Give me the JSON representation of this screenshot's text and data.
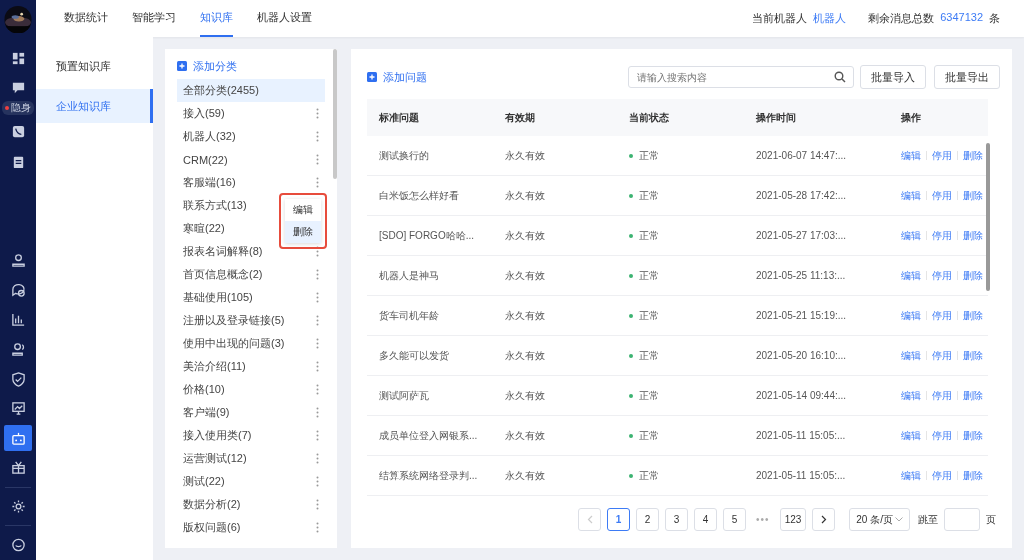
{
  "sidebar": {
    "status_badge": "隐身",
    "items": [
      {
        "selected": false
      },
      {
        "selected": false
      },
      {
        "selected": false
      },
      {
        "selected": false
      },
      {
        "selected": false
      },
      {
        "selected": false
      },
      {
        "selected": false
      },
      {
        "selected": false
      },
      {
        "selected": false
      },
      {
        "selected": false
      },
      {
        "selected": true
      },
      {
        "selected": false
      },
      {
        "selected": false
      },
      {
        "selected": false
      }
    ]
  },
  "top_tabs": [
    {
      "label": "数据统计",
      "selected": false
    },
    {
      "label": "智能学习",
      "selected": false
    },
    {
      "label": "知识库",
      "selected": true
    },
    {
      "label": "机器人设置",
      "selected": false
    }
  ],
  "header_info": {
    "robot_label": "当前机器人",
    "robot_name": "机器人",
    "messages_label": "剩余消息总数",
    "messages_count": "6347132",
    "messages_unit": "条"
  },
  "submenu": [
    {
      "label": "预置知识库",
      "selected": false
    },
    {
      "label": "企业知识库",
      "selected": true
    }
  ],
  "categories": {
    "add_label": "添加分类",
    "items": [
      {
        "label": "全部分类(2455)",
        "selected": true,
        "has_menu": false
      },
      {
        "label": "接入(59)",
        "selected": false,
        "has_menu": true
      },
      {
        "label": "机器人(32)",
        "selected": false,
        "has_menu": true
      },
      {
        "label": "CRM(22)",
        "selected": false,
        "has_menu": true
      },
      {
        "label": "客服端(16)",
        "selected": false,
        "has_menu": true
      },
      {
        "label": "联系方式(13)",
        "selected": false,
        "has_menu": false
      },
      {
        "label": "寒暄(22)",
        "selected": false,
        "has_menu": false
      },
      {
        "label": "报表名词解释(8)",
        "selected": false,
        "has_menu": true
      },
      {
        "label": "首页信息概念(2)",
        "selected": false,
        "has_menu": true
      },
      {
        "label": "基础使用(105)",
        "selected": false,
        "has_menu": true
      },
      {
        "label": "注册以及登录链接(5)",
        "selected": false,
        "has_menu": true
      },
      {
        "label": "使用中出现的问题(3)",
        "selected": false,
        "has_menu": true
      },
      {
        "label": "美洽介绍(11)",
        "selected": false,
        "has_menu": true
      },
      {
        "label": "价格(10)",
        "selected": false,
        "has_menu": true
      },
      {
        "label": "客户端(9)",
        "selected": false,
        "has_menu": true
      },
      {
        "label": "接入使用类(7)",
        "selected": false,
        "has_menu": true
      },
      {
        "label": "运营测试(12)",
        "selected": false,
        "has_menu": true
      },
      {
        "label": "测试(22)",
        "selected": false,
        "has_menu": true
      },
      {
        "label": "数据分析(2)",
        "selected": false,
        "has_menu": true
      },
      {
        "label": "版权问题(6)",
        "selected": false,
        "has_menu": true
      }
    ],
    "context_menu": [
      {
        "label": "编辑",
        "selected": false
      },
      {
        "label": "删除",
        "selected": true
      }
    ]
  },
  "toolbar": {
    "add_label": "添加问题",
    "search": {
      "placeholder": "请输入搜索内容"
    },
    "buttons": [
      "批量导入",
      "批量导出"
    ]
  },
  "table": {
    "columns": [
      "标准问题",
      "有效期",
      "当前状态",
      "操作时间",
      "操作"
    ],
    "rows": [
      {
        "question": "测试换行的",
        "validity": "永久有效",
        "status": "正常",
        "time": "2021-06-07 14:47:...",
        "actions": [
          "编辑",
          "停用",
          "删除"
        ]
      },
      {
        "question": "白米饭怎么样好看",
        "validity": "永久有效",
        "status": "正常",
        "time": "2021-05-28 17:42:...",
        "actions": [
          "编辑",
          "停用",
          "删除"
        ]
      },
      {
        "question": "[SDO] FORGO哈哈...",
        "validity": "永久有效",
        "status": "正常",
        "time": "2021-05-27 17:03:...",
        "actions": [
          "编辑",
          "停用",
          "删除"
        ]
      },
      {
        "question": "机器人是神马",
        "validity": "永久有效",
        "status": "正常",
        "time": "2021-05-25 11:13:...",
        "actions": [
          "编辑",
          "停用",
          "删除"
        ]
      },
      {
        "question": "货车司机年龄",
        "validity": "永久有效",
        "status": "正常",
        "time": "2021-05-21 15:19:...",
        "actions": [
          "编辑",
          "停用",
          "删除"
        ]
      },
      {
        "question": "多久能可以发货",
        "validity": "永久有效",
        "status": "正常",
        "time": "2021-05-20 16:10:...",
        "actions": [
          "编辑",
          "停用",
          "删除"
        ]
      },
      {
        "question": "测试阿萨瓦",
        "validity": "永久有效",
        "status": "正常",
        "time": "2021-05-14 09:44:...",
        "actions": [
          "编辑",
          "停用",
          "删除"
        ]
      },
      {
        "question": "成员单位登入网银系...",
        "validity": "永久有效",
        "status": "正常",
        "time": "2021-05-11 15:05:...",
        "actions": [
          "编辑",
          "停用",
          "删除"
        ]
      },
      {
        "question": "结算系统网络登录判...",
        "validity": "永久有效",
        "status": "正常",
        "time": "2021-05-11 15:05:...",
        "actions": [
          "编辑",
          "停用",
          "删除"
        ]
      }
    ]
  },
  "pagination": {
    "prev_disabled": true,
    "pages": [
      {
        "label": "1",
        "selected": true
      },
      {
        "label": "2",
        "selected": false
      },
      {
        "label": "3",
        "selected": false
      },
      {
        "label": "4",
        "selected": false
      },
      {
        "label": "5",
        "selected": false
      },
      {
        "label": "•••",
        "kind": "ellipsis"
      },
      {
        "label": "123",
        "selected": false
      }
    ],
    "page_size": "20 条/页",
    "jump_label": "跳至",
    "jump_unit": "页"
  }
}
